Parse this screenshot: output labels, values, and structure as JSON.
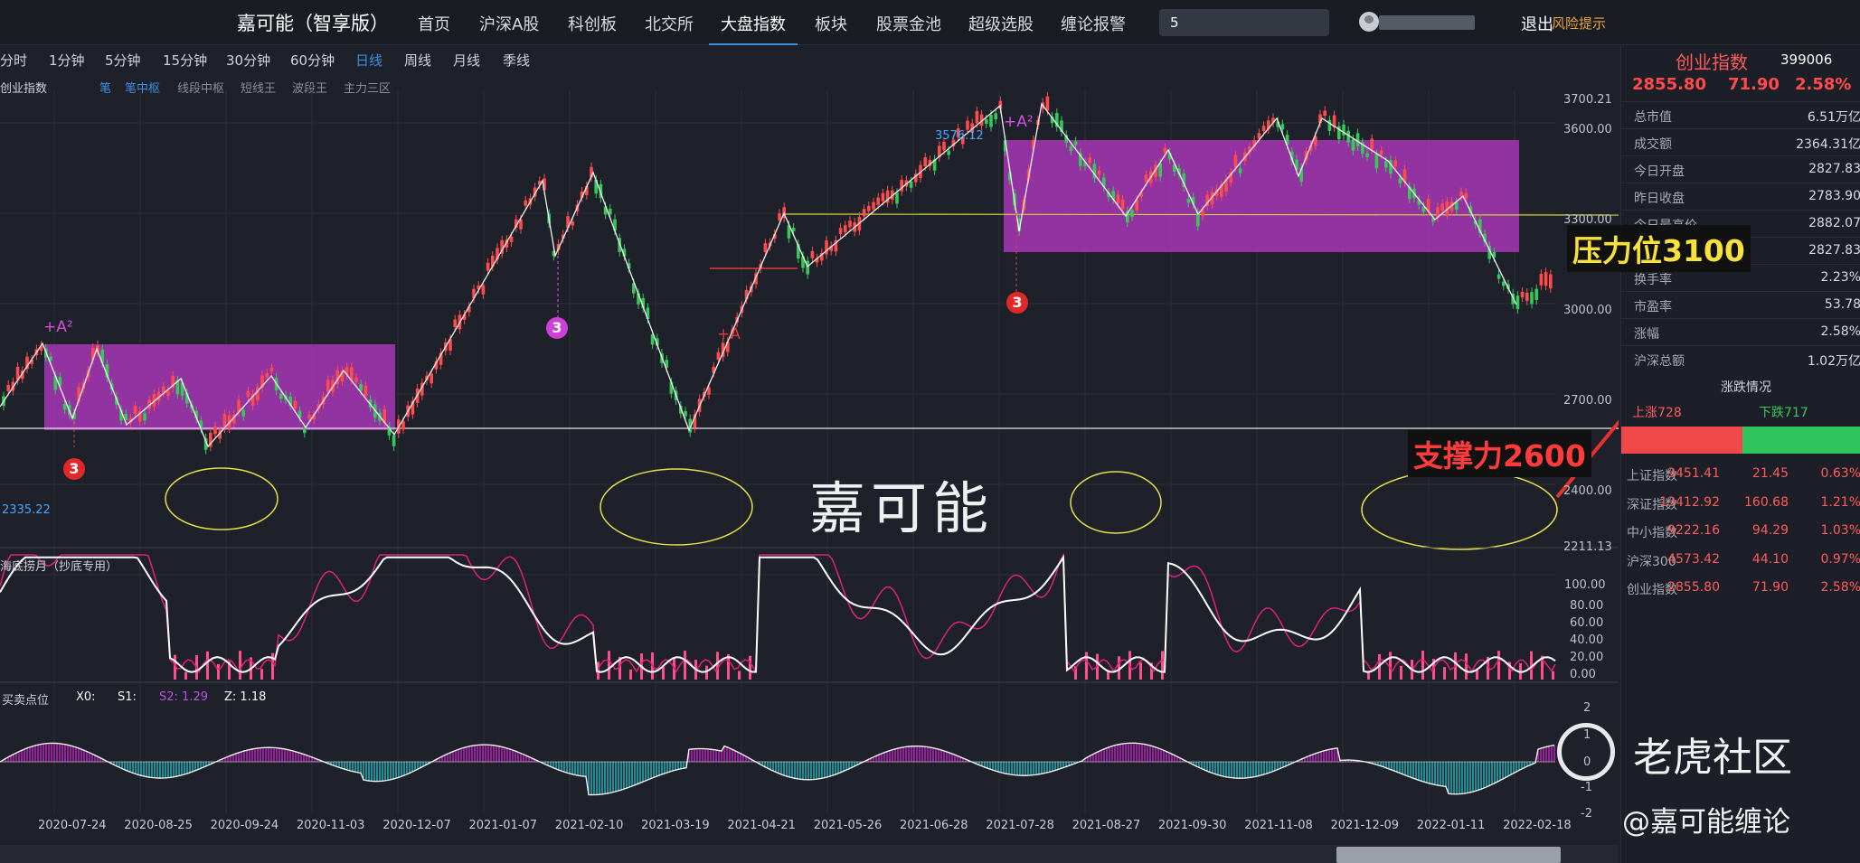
{
  "topnav": {
    "brand": "嘉可能（智享版）",
    "items": [
      "首页",
      "沪深A股",
      "科创板",
      "北交所",
      "大盘指数",
      "板块",
      "股票金池",
      "超级选股",
      "缠论报警"
    ],
    "active": "大盘指数",
    "search_value": "5",
    "logout": "退出",
    "risk": "风险提示"
  },
  "periods": {
    "items": [
      "分时",
      "1分钟",
      "5分钟",
      "15分钟",
      "30分钟",
      "60分钟",
      "日线",
      "周线",
      "月线",
      "季线"
    ],
    "active": "日线"
  },
  "main_panel": {
    "title": "创业指数",
    "sub_tabs": [
      "笔",
      "笔中枢",
      "线段中枢",
      "短线王",
      "波段王",
      "主力三区"
    ],
    "active_tabs": [
      "笔",
      "笔中枢"
    ],
    "y_ticks": [
      "3700.21",
      "3600.00",
      "3300.00",
      "3000.00",
      "2700.00",
      "2400.00",
      "2211.13"
    ],
    "high_label": "3576.12",
    "low_label": "2335.22",
    "markers": [
      "+A²",
      "+A²",
      "+A",
      "3",
      "3",
      "3"
    ],
    "watermark": "嘉可能"
  },
  "osc_panel": {
    "title": "海底捞月（抄底专用）",
    "y_ticks": [
      "100.00",
      "80.00",
      "60.00",
      "40.00",
      "20.00",
      "0.00"
    ]
  },
  "macd_panel": {
    "title": "买卖点位",
    "legend": {
      "x0": "X0:",
      "s1": "S1:",
      "s2": "S2: 1.29",
      "z": "Z: 1.18"
    },
    "y_ticks": [
      "2",
      "1",
      "0",
      "-1",
      "-2"
    ]
  },
  "x_dates": [
    "2020-07-24",
    "2020-08-25",
    "2020-09-24",
    "2020-11-03",
    "2020-12-07",
    "2021-01-07",
    "2021-02-10",
    "2021-03-19",
    "2021-04-21",
    "2021-05-26",
    "2021-06-28",
    "2021-07-28",
    "2021-08-27",
    "2021-09-30",
    "2021-11-08",
    "2021-12-09",
    "2022-01-11",
    "2022-02-18"
  ],
  "right_panel": {
    "name": "创业指数",
    "code": "399006",
    "price": "2855.80",
    "change": "71.90",
    "change_pct": "2.58%",
    "stats": [
      {
        "k": "总市值",
        "v": "6.51万亿"
      },
      {
        "k": "成交额",
        "v": "2364.31亿"
      },
      {
        "k": "今日开盘",
        "v": "2827.83"
      },
      {
        "k": "昨日收盘",
        "v": "2783.90"
      },
      {
        "k": "今日最高价",
        "v": "2882.07"
      },
      {
        "k": "今日最低价",
        "v": "2827.83"
      },
      {
        "k": "换手率",
        "v": "2.23%"
      },
      {
        "k": "市盈率",
        "v": "53.78"
      },
      {
        "k": "涨幅",
        "v": "2.58%"
      },
      {
        "k": "沪深总额",
        "v": "1.02万亿"
      }
    ],
    "breadth_title": "涨跌情况",
    "up": "上涨728",
    "down": "下跌717",
    "up_count": 728,
    "down_count": 717,
    "indices": [
      {
        "n": "上证指数",
        "p": "3451.41",
        "c": "21.45",
        "r": "0.63%"
      },
      {
        "n": "深证指数",
        "p": "13412.92",
        "c": "160.68",
        "r": "1.21%"
      },
      {
        "n": "中小指数",
        "p": "9222.16",
        "c": "94.29",
        "r": "1.03%"
      },
      {
        "n": "沪深300",
        "p": "4573.42",
        "c": "44.10",
        "r": "0.97%"
      },
      {
        "n": "创业指数",
        "p": "2855.80",
        "c": "71.90",
        "r": "2.58%"
      }
    ]
  },
  "annotations": {
    "pressure": "压力位3100",
    "support": "支撑力2600",
    "tiger": "老虎社区",
    "author": "@嘉可能缠论"
  },
  "colors": {
    "up": "#ff4b4b",
    "down": "#35c95a",
    "zone": "#9a35a8",
    "accent": "#3b8fe0"
  }
}
